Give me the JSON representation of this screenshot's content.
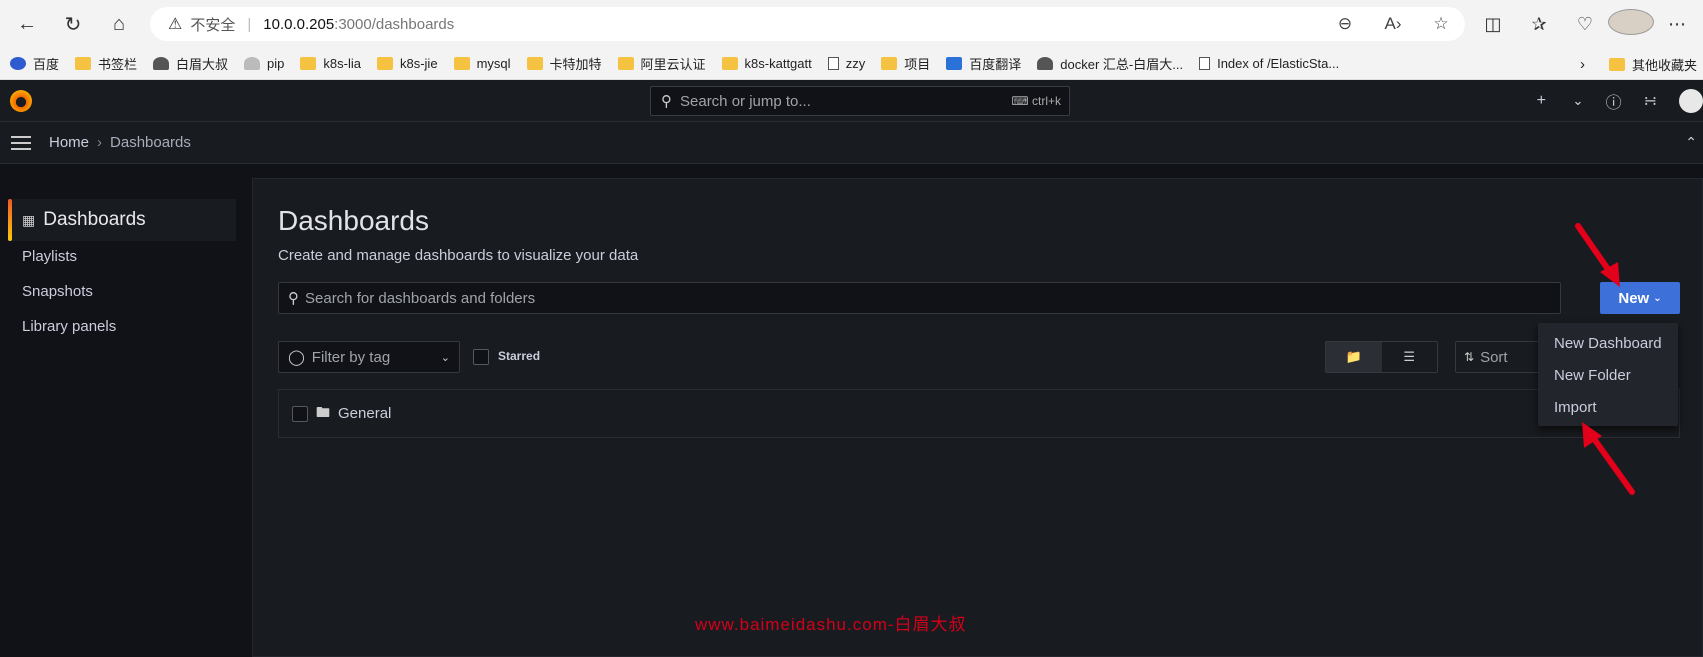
{
  "browser": {
    "url_warning": "不安全",
    "url_host": "10.0.0.205",
    "url_path": ":3000/dashboards",
    "bookmarks": [
      {
        "label": "百度",
        "icon": "paw-icon"
      },
      {
        "label": "书签栏",
        "icon": "folder-icon"
      },
      {
        "label": "白眉大叔",
        "icon": "person-icon"
      },
      {
        "label": "pip",
        "icon": "person-icon"
      },
      {
        "label": "k8s-lia",
        "icon": "folder-icon"
      },
      {
        "label": "k8s-jie",
        "icon": "folder-icon"
      },
      {
        "label": "mysql",
        "icon": "folder-icon"
      },
      {
        "label": "卡特加特",
        "icon": "folder-icon"
      },
      {
        "label": "阿里云认证",
        "icon": "folder-icon"
      },
      {
        "label": "k8s-kattgatt",
        "icon": "folder-icon"
      },
      {
        "label": "zzy",
        "icon": "page-icon"
      },
      {
        "label": "项目",
        "icon": "folder-icon"
      },
      {
        "label": "百度翻译",
        "icon": "translate-icon"
      },
      {
        "label": "docker 汇总-白眉大...",
        "icon": "person-icon"
      },
      {
        "label": "Index of /ElasticSta...",
        "icon": "page-icon"
      }
    ],
    "bookmarks_other": "其他收藏夹"
  },
  "grafana": {
    "search_placeholder": "Search or jump to...",
    "search_shortcut": "ctrl+k",
    "add_label": "+",
    "breadcrumb": {
      "home": "Home",
      "current": "Dashboards"
    }
  },
  "sidebar": {
    "active": "Dashboards",
    "items": [
      "Playlists",
      "Snapshots",
      "Library panels"
    ]
  },
  "main": {
    "title": "Dashboards",
    "subtitle": "Create and manage dashboards to visualize your data",
    "search_placeholder": "Search for dashboards and folders",
    "new_button": "New",
    "filter_tag_placeholder": "Filter by tag",
    "starred_label": "Starred",
    "sort_label": "Sort",
    "folders": [
      {
        "name": "General"
      }
    ]
  },
  "new_menu": {
    "items": [
      "New Dashboard",
      "New Folder",
      "Import"
    ]
  },
  "watermark": "www.baimeidashu.com-白眉大叔",
  "colors": {
    "primary_button": "#3d71d9",
    "arrow": "#e2001a"
  }
}
